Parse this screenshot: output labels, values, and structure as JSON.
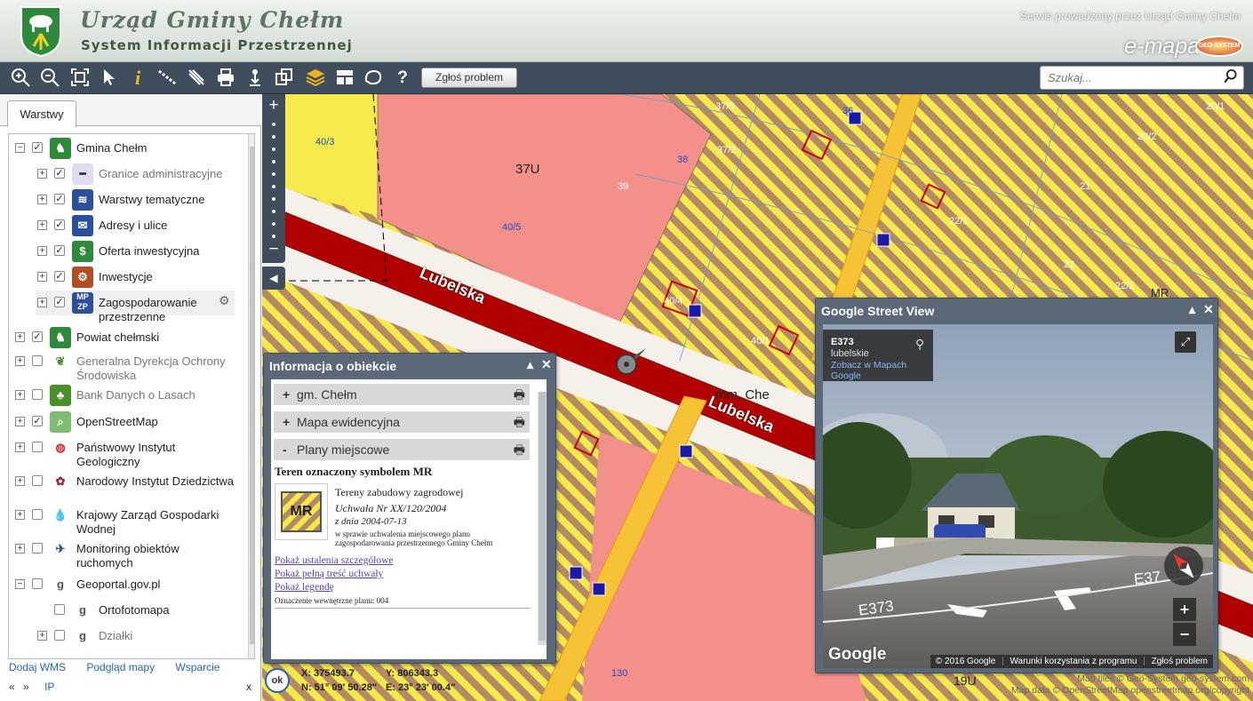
{
  "header": {
    "title": "Urząd Gminy Chełm",
    "subtitle": "System Informacji Przestrzennej",
    "service_note": "Serwis prowadzony przez Urząd Gminy Chełm",
    "brand": "e-mapa",
    "brand_badge": "GEO-SYSTEM"
  },
  "toolbar": {
    "report_label": "Zgłoś problem",
    "search_placeholder": "Szukaj...",
    "tools": [
      "zoom-in-icon",
      "zoom-out-icon",
      "zoom-extent-icon",
      "pointer-icon",
      "info-icon",
      "measure-distance-icon",
      "measure-area-icon",
      "print-icon",
      "identify-icon",
      "copy-icon",
      "layers-icon",
      "layout-icon",
      "draw-icon",
      "help-icon"
    ]
  },
  "sidebar": {
    "tab_label": "Warstwy",
    "layers": [
      {
        "label": "Gmina Chełm",
        "expand": "−",
        "checked": true,
        "indent": 0,
        "icon": "coat-of-arms-icon"
      },
      {
        "label": "Granice administracyjne",
        "expand": "+",
        "checked": true,
        "indent": 1,
        "grey": true,
        "icon": "boundary-icon"
      },
      {
        "label": "Warstwy tematyczne",
        "expand": "+",
        "checked": true,
        "indent": 1,
        "icon": "stack-icon"
      },
      {
        "label": "Adresy i ulice",
        "expand": "+",
        "checked": true,
        "indent": 1,
        "icon": "envelope-icon"
      },
      {
        "label": "Oferta inwestycyjna",
        "expand": "+",
        "checked": true,
        "indent": 1,
        "icon": "dollar-icon"
      },
      {
        "label": "Inwestycje",
        "expand": "+",
        "checked": true,
        "indent": 1,
        "icon": "factory-icon"
      },
      {
        "label": "Zagospodarowanie przestrzenne",
        "expand": "+",
        "checked": true,
        "indent": 1,
        "icon": "mpzp-icon",
        "gear": true
      },
      {
        "label": "Powiat chełmski",
        "expand": "+",
        "checked": true,
        "indent": 0,
        "icon": "powiat-icon"
      },
      {
        "label": "Generalna Dyrekcja Ochrony Środowiska",
        "expand": "+",
        "checked": false,
        "indent": 0,
        "grey": true,
        "icon": "leaf-icon"
      },
      {
        "label": "Bank Danych o Lasach",
        "expand": "+",
        "checked": false,
        "indent": 0,
        "grey": true,
        "icon": "tree-icon"
      },
      {
        "label": "OpenStreetMap",
        "expand": "+",
        "checked": true,
        "indent": 0,
        "icon": "osm-icon"
      },
      {
        "label": "Państwowy Instytut Geologiczny",
        "expand": "+",
        "checked": false,
        "indent": 0,
        "icon": "pig-icon"
      },
      {
        "label": "Narodowy Instytut Dziedzictwa",
        "expand": "+",
        "checked": false,
        "indent": 0,
        "icon": "nid-icon"
      },
      {
        "label": "Krajowy Zarząd Gospodarki Wodnej",
        "expand": "+",
        "checked": false,
        "indent": 0,
        "icon": "water-drop-icon"
      },
      {
        "label": "Monitoring obiektów ruchomych",
        "expand": "+",
        "checked": false,
        "indent": 0,
        "icon": "satellite-icon"
      },
      {
        "label": "Geoportal.gov.pl",
        "expand": "−",
        "checked": false,
        "indent": 0,
        "icon": "geoportal-icon"
      },
      {
        "label": "Ortofotomapa",
        "expand": "",
        "checked": false,
        "indent": 1,
        "icon": "geoportal-icon"
      },
      {
        "label": "Działki",
        "expand": "+",
        "checked": false,
        "indent": 1,
        "grey": true,
        "icon": "geoportal-icon"
      }
    ],
    "links": [
      "Dodaj WMS",
      "Podgląd mapy",
      "Wsparcie"
    ],
    "nav": {
      "prev": "«",
      "next": "»",
      "ip": "IP",
      "close": "x"
    }
  },
  "map": {
    "labels": [
      "40/3",
      "37U",
      "39",
      "37/5",
      "36",
      "37/2",
      "38",
      "20/1",
      "20/2",
      "21",
      "40/5",
      "22/1",
      "22",
      "22/2",
      "MR",
      "40/4",
      "40/1",
      "mm. Che",
      "19U",
      "130"
    ],
    "streets": [
      "Lubelska",
      "Lubelska"
    ]
  },
  "info_panel": {
    "title": "Informacja o obiekcie",
    "sections": [
      {
        "sign": "+",
        "label": "gm. Chełm"
      },
      {
        "sign": "+",
        "label": "Mapa ewidencyjna"
      },
      {
        "sign": "-",
        "label": "Plany miejscowe"
      }
    ],
    "heading": "Teren oznaczony symbolem MR",
    "symbol": "MR",
    "description": "Tereny zabudowy zagrodowej",
    "resolution": "Uchwała Nr XX/120/2004",
    "date": "z dnia 2004-07-13",
    "subject": "w sprawie uchwalenia miejscowego planu zagospodarowania przestrzennego Gminy Chełm",
    "links": [
      "Pokaż ustalenia szczegółowe",
      "Pokaż pełną treść uchwały",
      "Pokaż legendę"
    ],
    "internal": "Oznaczenie wewnętrzne planu: 004"
  },
  "coords": {
    "ok": "ok",
    "x": "X: 375493.7",
    "y": "Y: 806343.3",
    "n": "N: 51° 09′ 50.28″",
    "e": "E: 23° 23′ 00.4″"
  },
  "street_view": {
    "title": "Google Street View",
    "road": "E373",
    "region": "lubelskie",
    "maps_link": "Zobacz w Mapach Google",
    "road_marks": [
      "E373",
      "E37"
    ],
    "google": "Google",
    "footer": [
      "© 2016 Google",
      "Warunki korzystania z programu",
      "Zgłoś problem"
    ]
  },
  "copyright": {
    "line1": "Map tiles © Geo-System geo-system.com",
    "line2": "Map data © OpenStreetMap openstreetmap.org/copyright"
  },
  "colors": {
    "toolbar": "#3f4d5d",
    "residential_pink": "#f4908a",
    "agri_yellow": "#f5e94c",
    "hatch_brown": "#b48a64",
    "road_red": "#b00000",
    "link_blue": "#2a64b5"
  }
}
